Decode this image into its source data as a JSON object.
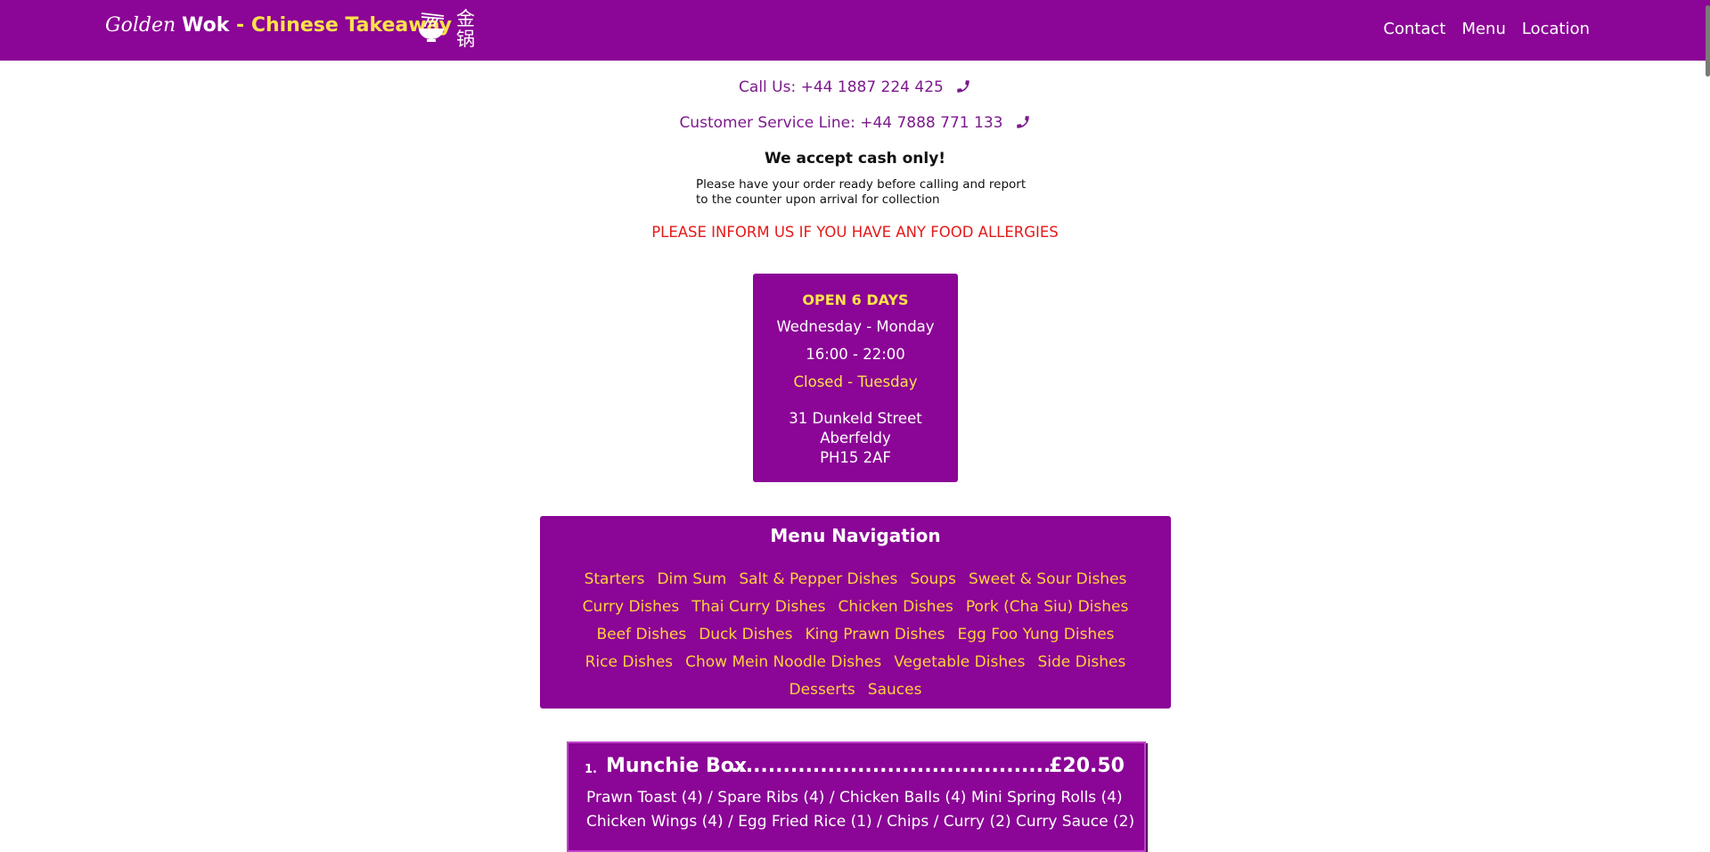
{
  "nav": {
    "brand_golden": "Golden",
    "brand_wok": "Wok",
    "brand_dash": " - ",
    "brand_sub": "Chinese Takeaway",
    "brand_chinese_1": "金",
    "brand_chinese_2": "锅",
    "links": [
      "Contact",
      "Menu",
      "Location"
    ]
  },
  "contact": {
    "call_us": "Call Us: +44 1887 224 425",
    "customer_service": "Customer Service Line: +44 7888 771 133",
    "cash_only": "We accept cash only!",
    "note_line1": "Please have your order ready before calling and report",
    "note_line2": "to the counter upon arrival for collection",
    "allergy": "PLEASE INFORM US IF YOU HAVE ANY FOOD ALLERGIES"
  },
  "hours": {
    "open": "OPEN 6 DAYS",
    "days": "Wednesday - Monday",
    "time": "16:00 - 22:00",
    "closed": "Closed - Tuesday",
    "address1": "31 Dunkeld Street",
    "address2": "Aberfeldy",
    "address3": "PH15 2AF"
  },
  "menu_nav": {
    "title": "Menu Navigation",
    "links": [
      "Starters",
      "Dim Sum",
      "Salt & Pepper Dishes",
      "Soups",
      "Sweet & Sour Dishes",
      "Curry Dishes",
      "Thai Curry Dishes",
      "Chicken Dishes",
      "Pork (Cha Siu) Dishes",
      "Beef Dishes",
      "Duck Dishes",
      "King Prawn Dishes",
      "Egg Foo Yung Dishes",
      "Rice Dishes",
      "Chow Mein Noodle Dishes",
      "Vegetable Dishes",
      "Side Dishes",
      "Desserts",
      "Sauces"
    ]
  },
  "first_item": {
    "number": "1.",
    "name": "Munchie Box",
    "dots": "...........................................................................",
    "price": "£20.50",
    "description": "Prawn Toast (4) / Spare Ribs (4) / Chicken Balls (4) Mini Spring Rolls (4)",
    "description2": "Chicken Wings (4) / Egg Fried Rice (1) / Chips / Curry (2) Curry Sauce (2)"
  },
  "colors": {
    "purple": "#8b0596",
    "yellow": "#ffe24a",
    "red": "#e41a1a"
  },
  "icons": [
    "bowl-icon",
    "phone-icon"
  ]
}
